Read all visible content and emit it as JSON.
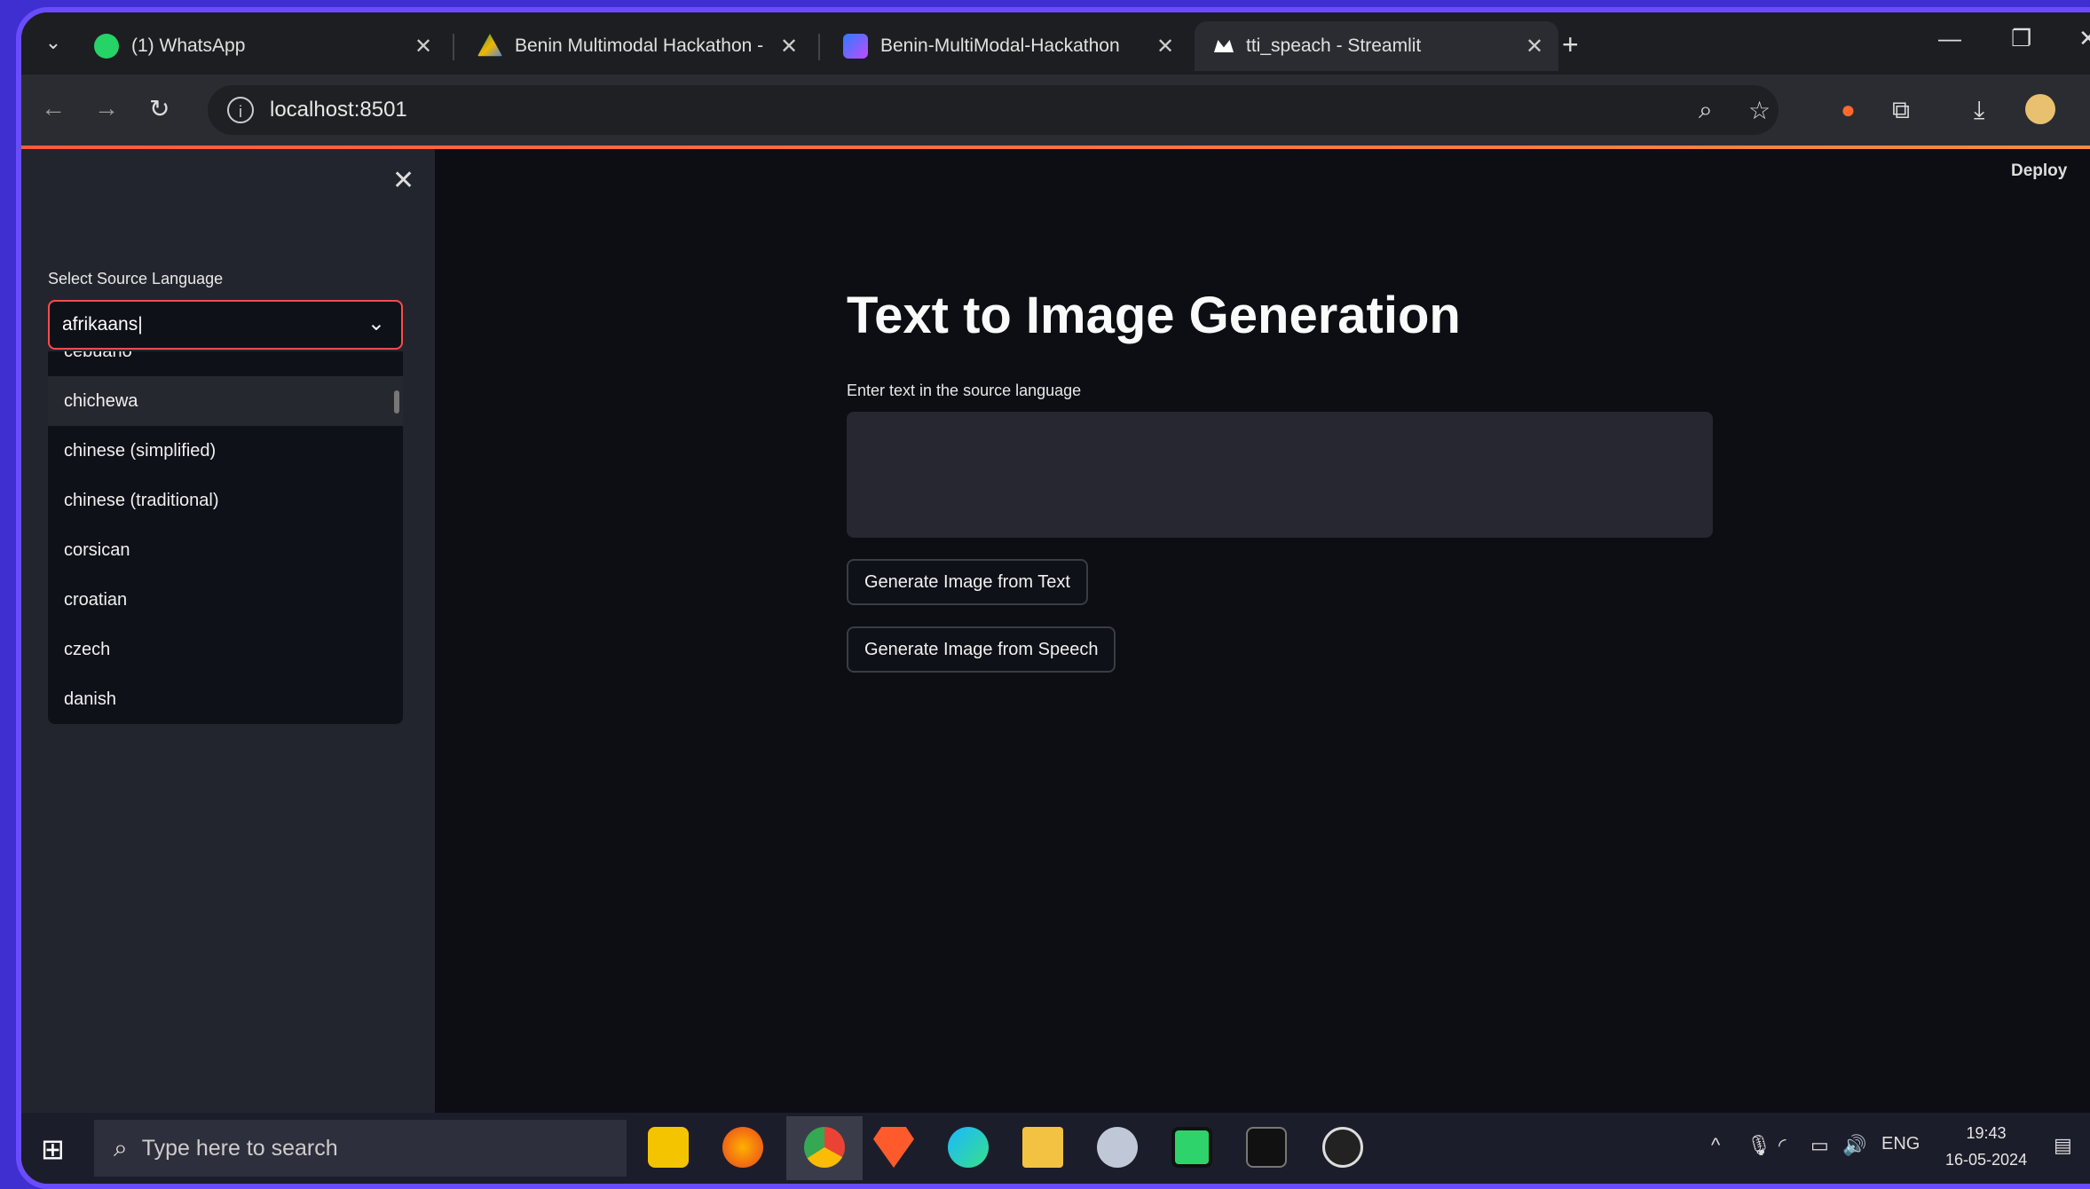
{
  "browser": {
    "tabs": [
      {
        "title": "(1) WhatsApp",
        "icon": "whatsapp-icon",
        "color": "#25d366"
      },
      {
        "title": "Benin Multimodal Hackathon -",
        "icon": "google-drive-icon",
        "color": "#f4b400"
      },
      {
        "title": "Benin-MultiModal-Hackathon",
        "icon": "colab-icon",
        "color": "#a05cff"
      },
      {
        "title": "tti_speach - Streamlit",
        "icon": "streamlit-icon",
        "color": "#ffffff"
      }
    ],
    "url": "localhost:8501"
  },
  "app": {
    "deploy_label": "Deploy",
    "sidebar": {
      "select_label": "Select Source Language",
      "select_value": "afrikaans",
      "options": [
        "cebuano",
        "chichewa",
        "chinese (simplified)",
        "chinese (traditional)",
        "corsican",
        "croatian",
        "czech",
        "danish"
      ],
      "highlighted_option": "chichewa"
    },
    "main": {
      "title": "Text to Image Generation",
      "input_label": "Enter text in the source language",
      "input_value": "",
      "buttons": [
        "Generate Image from Text",
        "Generate Image from Speech"
      ]
    }
  },
  "taskbar": {
    "search_placeholder": "Type here to search",
    "language": "ENG",
    "time": "19:43",
    "date": "16-05-2024"
  },
  "colors": {
    "accent": "#ff4b4b",
    "background": "#0e1117",
    "sidebar": "#262730"
  }
}
